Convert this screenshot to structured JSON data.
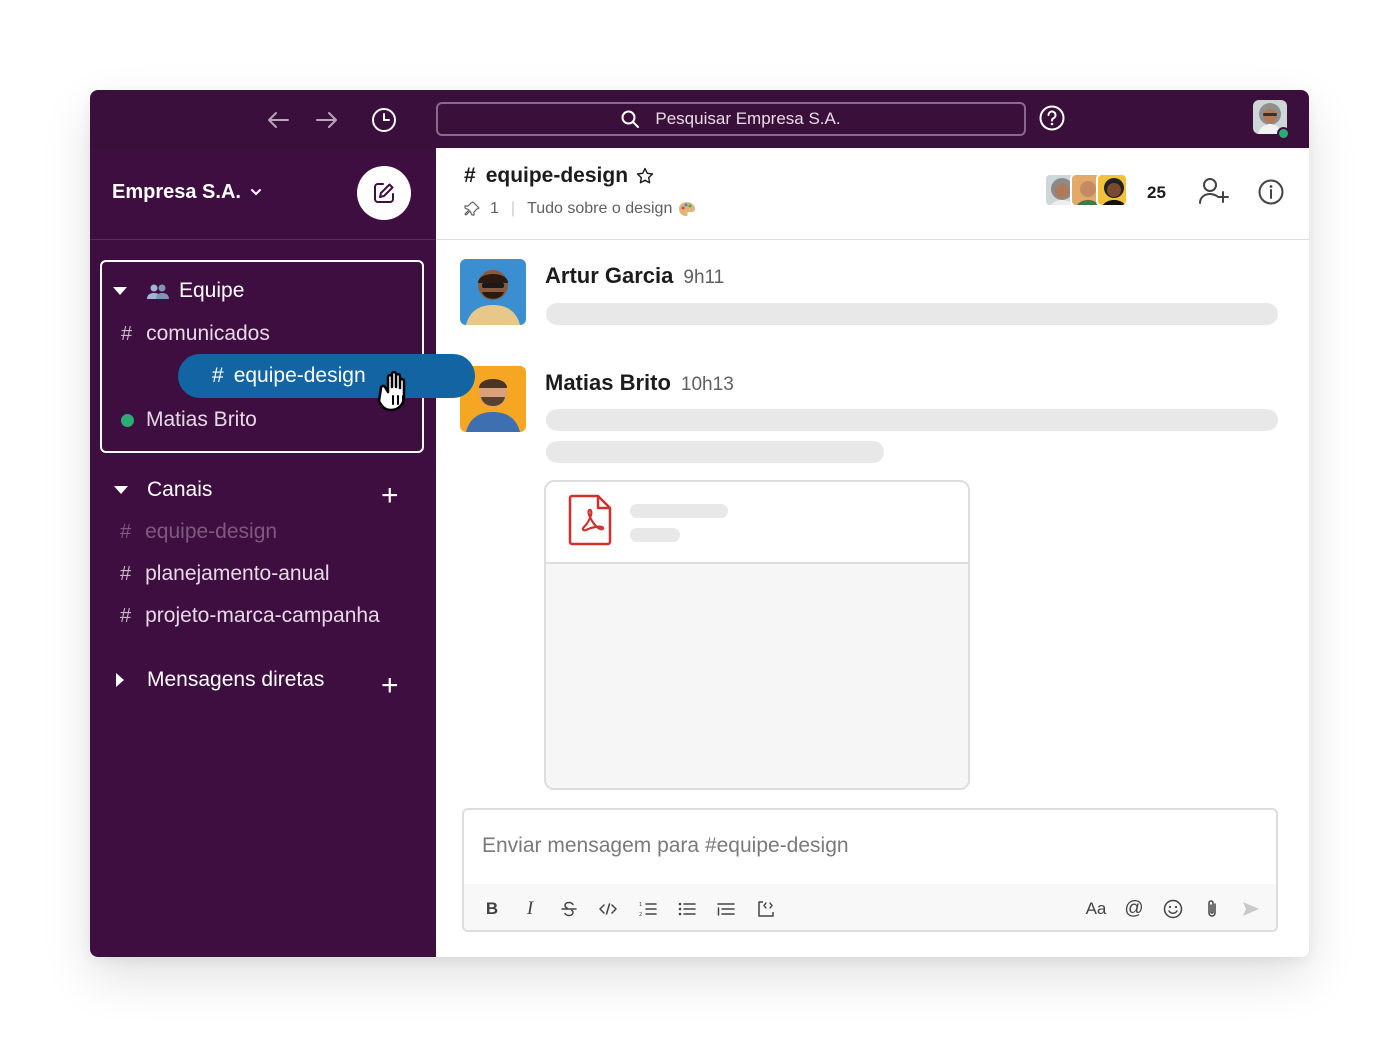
{
  "topbar": {
    "search_placeholder": "Pesquisar Empresa S.A.",
    "back_icon": "arrow-left-icon",
    "forward_icon": "arrow-right-icon",
    "history_icon": "clock-icon",
    "help_icon": "question-circle-icon"
  },
  "sidebar": {
    "workspace_name": "Empresa S.A.",
    "group": {
      "title": "Equipe",
      "items": [
        {
          "label": "comunicados"
        },
        {
          "label": "equipe-design"
        },
        {
          "label": "Matias Brito"
        }
      ]
    },
    "channels": {
      "title": "Canais",
      "items": [
        {
          "label": "equipe-design"
        },
        {
          "label": "planejamento-anual"
        },
        {
          "label": "projeto-marca-campanha"
        }
      ]
    },
    "direct_messages": {
      "title": "Mensagens diretas"
    },
    "hash": "#"
  },
  "channel": {
    "name": "equipe-design",
    "hash": "#",
    "pinned_count": "1",
    "topic": "Tudo sobre o design",
    "member_count": "25"
  },
  "messages": [
    {
      "author": "Artur Garcia",
      "time": "9h11"
    },
    {
      "author": "Matias Brito",
      "time": "10h13"
    }
  ],
  "composer": {
    "placeholder": "Enviar mensagem para #equipe-design",
    "bold_label": "B",
    "italic_label": "I",
    "text_format_label": "Aa",
    "mention_label": "@"
  },
  "colors": {
    "sidebar": "#3f0e40",
    "topbar": "#3b0f3b",
    "accent": "#1264a3",
    "presence": "#2bac76",
    "pdf_red": "#d0312d"
  }
}
